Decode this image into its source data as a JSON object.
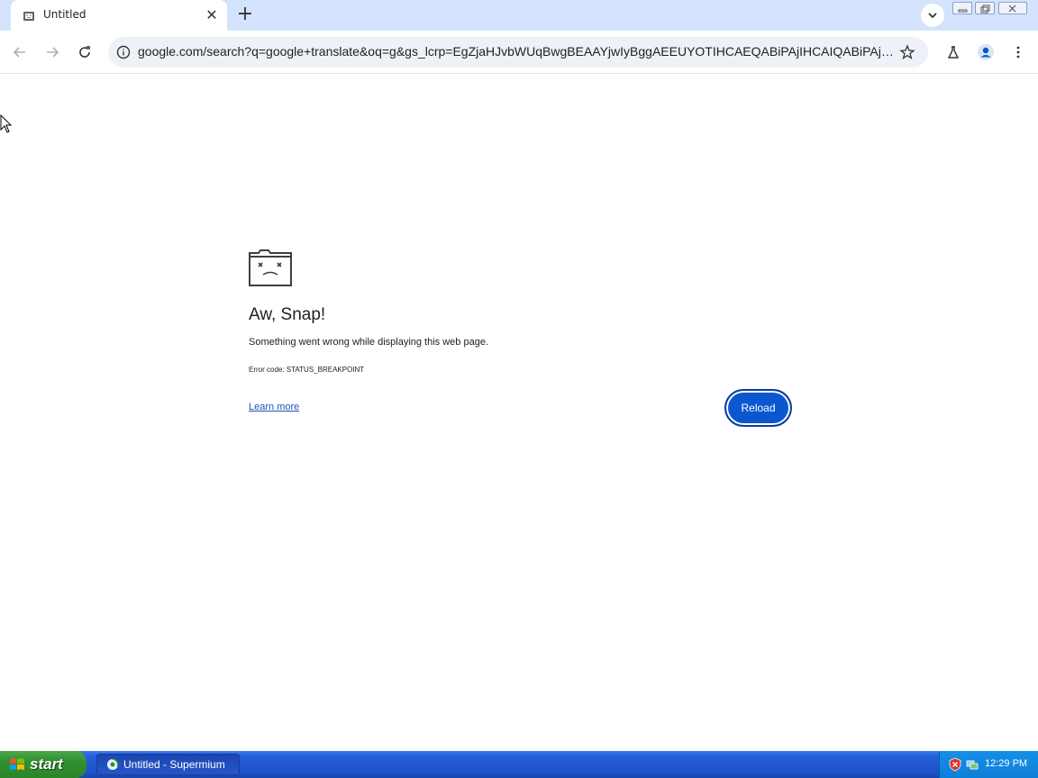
{
  "browser": {
    "tab": {
      "title": "Untitled"
    },
    "address_bar": {
      "url": "google.com/search?q=google+translate&oq=g&gs_lcrp=EgZjaHJvbWUqBwgBEAAYjwIyBggAEEUYOTIHCAEQABiPAjIHCAIQABiPAjIHC..."
    }
  },
  "page": {
    "heading": "Aw, Snap!",
    "message": "Something went wrong while displaying this web page.",
    "error_code": "Error code: STATUS_BREAKPOINT",
    "learn_more": "Learn more",
    "reload_label": "Reload"
  },
  "taskbar": {
    "start_label": "start",
    "task_label": "Untitled - Supermium",
    "clock": "12:29 PM"
  },
  "colors": {
    "accent": "#0b57d0",
    "tabstrip": "#d3e3fd",
    "taskbar": "#245edb",
    "start_green": "#2f8f2f"
  }
}
